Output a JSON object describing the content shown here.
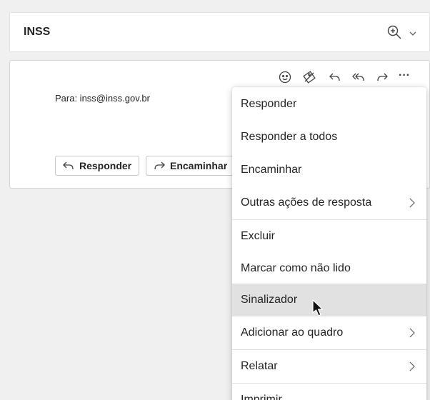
{
  "header": {
    "title": "INSS",
    "zoom_icon": "zoom-in-icon",
    "chevron_icon": "chevron-down-icon"
  },
  "mail": {
    "to_line": "Para: inss@inss.gov.br",
    "toolbar_icons": [
      "emoji-icon",
      "tag-icon",
      "reply-icon",
      "reply-all-icon",
      "forward-icon",
      "more-icon"
    ],
    "more_label": "···",
    "reply_button": "Responder",
    "forward_button": "Encaminhar"
  },
  "menu": {
    "items": [
      {
        "label": "Responder",
        "submenu": false
      },
      {
        "label": "Responder a todos",
        "submenu": false
      },
      {
        "label": "Encaminhar",
        "submenu": false
      },
      {
        "label": "Outras ações de resposta",
        "submenu": true
      },
      {
        "label": "Excluir",
        "submenu": false
      },
      {
        "label": "Marcar como não lido",
        "submenu": false
      },
      {
        "label": "Sinalizador",
        "submenu": false,
        "hovered": true
      },
      {
        "label": "Adicionar ao quadro",
        "submenu": true
      },
      {
        "label": "Relatar",
        "submenu": true
      },
      {
        "label": "Imprimir",
        "submenu": false
      }
    ]
  },
  "colors": {
    "hover": "#e1e1e1",
    "text": "#242424",
    "background": "#f0f0f0"
  }
}
